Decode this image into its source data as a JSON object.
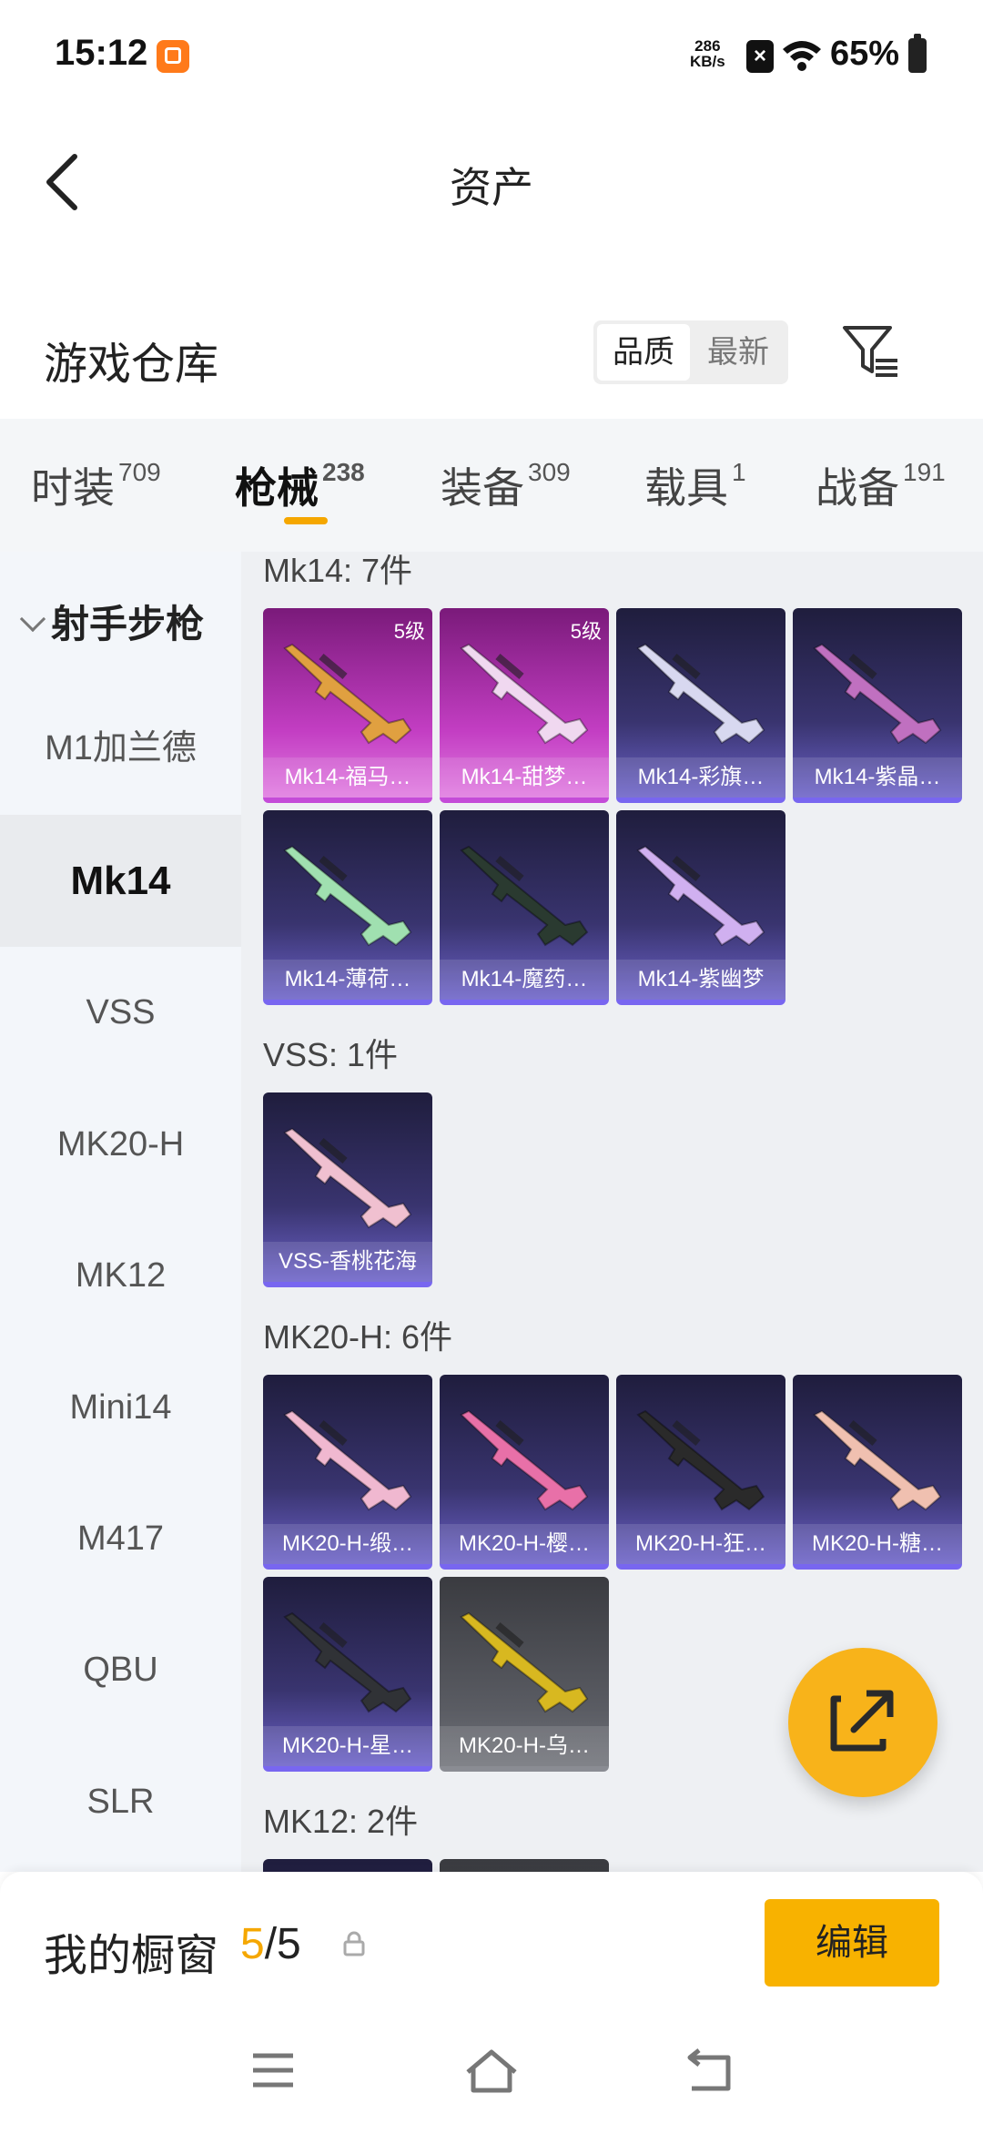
{
  "status_bar": {
    "time": "15:12",
    "net_speed_value": "286",
    "net_speed_unit": "KB/s",
    "battery": "65%"
  },
  "header": {
    "title": "资产"
  },
  "section": {
    "title": "游戏仓库",
    "sort_options": [
      "品质",
      "最新"
    ],
    "active_sort": "品质"
  },
  "tabs": [
    {
      "label": "时装",
      "count": "709"
    },
    {
      "label": "枪械",
      "count": "238"
    },
    {
      "label": "装备",
      "count": "309"
    },
    {
      "label": "载具",
      "count": "1"
    },
    {
      "label": "战备",
      "count": "191"
    }
  ],
  "active_tab": "枪械",
  "sidebar": {
    "group": "射手步枪",
    "items": [
      "M1加兰德",
      "Mk14",
      "VSS",
      "MK20-H",
      "MK12",
      "Mini14",
      "M417",
      "QBU",
      "SLR"
    ],
    "active": "Mk14"
  },
  "groups": [
    {
      "label": "Mk14: 7件",
      "items": [
        {
          "name": "Mk14-福马…",
          "level": "5级",
          "style": "pink"
        },
        {
          "name": "Mk14-甜梦…",
          "level": "5级",
          "style": "pink"
        },
        {
          "name": "Mk14-彩旗…",
          "level": "",
          "style": "purple"
        },
        {
          "name": "Mk14-紫晶…",
          "level": "",
          "style": "purple"
        },
        {
          "name": "Mk14-薄荷…",
          "level": "",
          "style": "purple"
        },
        {
          "name": "Mk14-魔药…",
          "level": "",
          "style": "purple"
        },
        {
          "name": "Mk14-紫幽梦",
          "level": "",
          "style": "purple"
        }
      ]
    },
    {
      "label": "VSS: 1件",
      "items": [
        {
          "name": "VSS-香桃花海",
          "level": "",
          "style": "purple"
        }
      ]
    },
    {
      "label": "MK20-H: 6件",
      "items": [
        {
          "name": "MK20-H-缎…",
          "level": "",
          "style": "purple"
        },
        {
          "name": "MK20-H-樱…",
          "level": "",
          "style": "purple"
        },
        {
          "name": "MK20-H-狂…",
          "level": "",
          "style": "purple"
        },
        {
          "name": "MK20-H-糖…",
          "level": "",
          "style": "purple"
        },
        {
          "name": "MK20-H-星…",
          "level": "",
          "style": "purple"
        },
        {
          "name": "MK20-H-乌…",
          "level": "",
          "style": "grey"
        }
      ]
    },
    {
      "label": "MK12: 2件",
      "items": []
    }
  ],
  "showcase": {
    "label": "我的橱窗",
    "current": "5",
    "total": "/5",
    "edit_label": "编辑"
  },
  "colors": {
    "accent": "#f5a700",
    "card_purple": "#39346f",
    "card_pink": "#c33ec3",
    "card_grey": "#5a5c63"
  }
}
